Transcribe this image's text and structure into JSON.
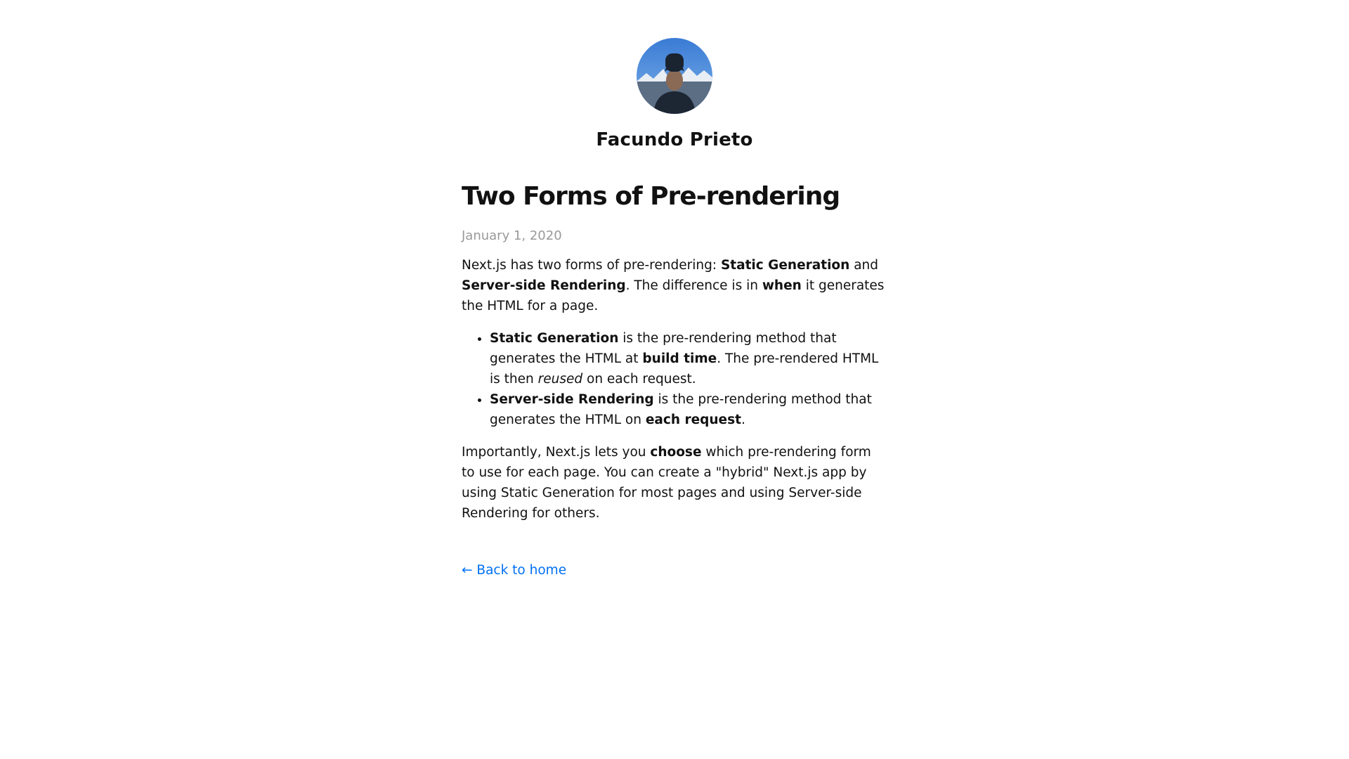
{
  "author": {
    "name": "Facundo Prieto",
    "avatar_icon": "profile-photo"
  },
  "post": {
    "title": "Two Forms of Pre-rendering",
    "date": "January 1, 2020",
    "p1": {
      "t1": "Next.js has two forms of pre-rendering: ",
      "b1": "Static Generation",
      "t2": " and ",
      "b2": "Server-side Rendering",
      "t3": ". The difference is in ",
      "b3": "when",
      "t4": " it generates the HTML for a page."
    },
    "list": [
      {
        "b1": "Static Generation",
        "t1": " is the pre-rendering method that generates the HTML at ",
        "b2": "build time",
        "t2": ". The pre-rendered HTML is then ",
        "i1": "reused",
        "t3": " on each request."
      },
      {
        "b1": "Server-side Rendering",
        "t1": " is the pre-rendering method that generates the HTML on ",
        "b2": "each request",
        "t2": "."
      }
    ],
    "p2": {
      "t1": "Importantly, Next.js lets you ",
      "b1": "choose",
      "t2": " which pre-rendering form to use for each page. You can create a \"hybrid\" Next.js app by using Static Generation for most pages and using Server-side Rendering for others."
    }
  },
  "nav": {
    "back_label": "← Back to home"
  },
  "colors": {
    "link": "#0070f3",
    "date": "#999999",
    "text": "#111111"
  }
}
